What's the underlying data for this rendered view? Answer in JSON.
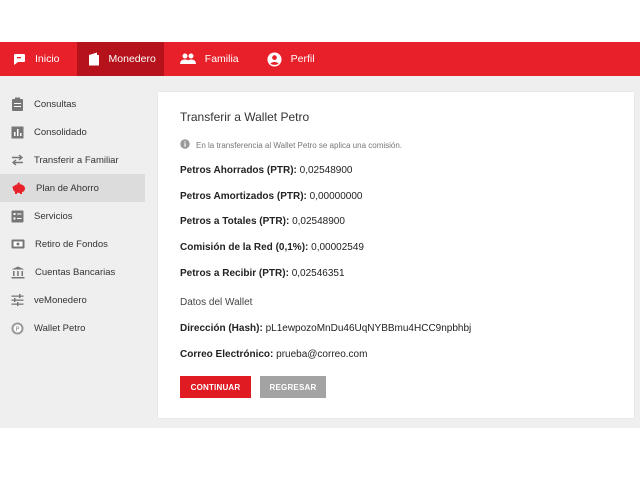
{
  "navbar": {
    "items": [
      {
        "label": "Inicio",
        "icon": "chat-bubble-icon"
      },
      {
        "label": "Monedero",
        "icon": "wallet-icon",
        "active": true
      },
      {
        "label": "Familia",
        "icon": "people-icon"
      },
      {
        "label": "Perfil",
        "icon": "account-circle-icon"
      }
    ],
    "color": "#e8202a",
    "active_color": "#b5121b"
  },
  "sidebar": {
    "items": [
      {
        "label": "Consultas",
        "icon": "clipboard-icon"
      },
      {
        "label": "Consolidado",
        "icon": "bar-chart-icon"
      },
      {
        "label": "Transferir a Familiar",
        "icon": "swap-arrows-icon"
      },
      {
        "label": "Plan de Ahorro",
        "icon": "piggy-bank-icon",
        "active": true
      },
      {
        "label": "Servicios",
        "icon": "list-box-icon"
      },
      {
        "label": "Retiro de Fondos",
        "icon": "cash-icon"
      },
      {
        "label": "Cuentas Bancarias",
        "icon": "bank-icon"
      },
      {
        "label": "veMonedero",
        "icon": "sliders-icon"
      },
      {
        "label": "Wallet Petro",
        "icon": "petro-coin-icon"
      }
    ]
  },
  "card": {
    "title": "Transferir a Wallet Petro",
    "note": "En la transferencia al Wallet Petro se aplica una comisión.",
    "rows": [
      {
        "label": "Petros Ahorrados (PTR):",
        "value": "0,02548900"
      },
      {
        "label": "Petros Amortizados (PTR):",
        "value": "0,00000000"
      },
      {
        "label": "Petros a Totales (PTR):",
        "value": "0,02548900"
      },
      {
        "label": "Comisión de la Red (0,1%):",
        "value": "0,00002549"
      },
      {
        "label": "Petros a Recibir (PTR):",
        "value": "0,02546351"
      }
    ],
    "wallet_section_title": "Datos del Wallet",
    "wallet_rows": [
      {
        "label": "Dirección (Hash):",
        "value": "pL1ewpozoMnDu46UqNYBBmu4HCC9npbhbj"
      },
      {
        "label": "Correo Electrónico:",
        "value": "prueba@correo.com"
      }
    ],
    "continue_label": "CONTINUAR",
    "back_label": "REGRESAR"
  }
}
